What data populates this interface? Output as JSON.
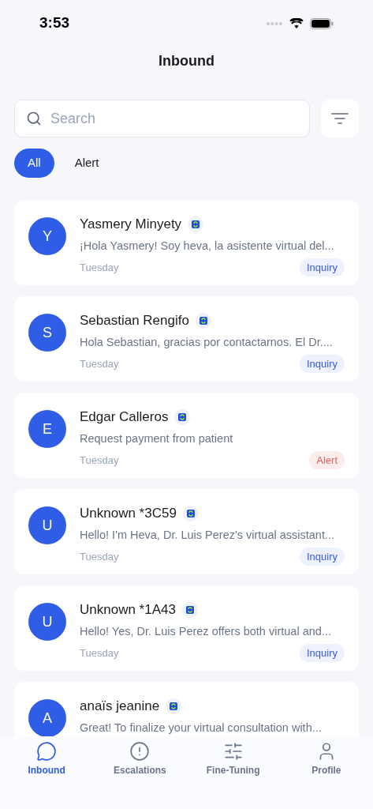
{
  "status_bar": {
    "time": "3:53"
  },
  "title": "Inbound",
  "search": {
    "placeholder": "Search"
  },
  "filters": [
    {
      "label": "All",
      "selected": true
    },
    {
      "label": "Alert",
      "selected": false
    }
  ],
  "conversations": [
    {
      "initial": "Y",
      "name": "Yasmery Minyety",
      "preview": "¡Hola Yasmery! Soy heva, la asistente virtual del...",
      "date": "Tuesday",
      "tag": {
        "label": "Inquiry",
        "kind": "inquiry"
      }
    },
    {
      "initial": "S",
      "name": "Sebastian Rengifo",
      "preview": "Hola Sebastian, gracias por contactarnos. El Dr....",
      "date": "Tuesday",
      "tag": {
        "label": "Inquiry",
        "kind": "inquiry"
      }
    },
    {
      "initial": "E",
      "name": "Edgar Calleros",
      "preview": "Request payment from patient",
      "date": "Tuesday",
      "tag": {
        "label": "Alert",
        "kind": "alert"
      }
    },
    {
      "initial": "U",
      "name": "Unknown *3C59",
      "preview": "Hello! I'm Heva, Dr. Luis Perez's virtual assistant...",
      "date": "Tuesday",
      "tag": {
        "label": "Inquiry",
        "kind": "inquiry"
      }
    },
    {
      "initial": "U",
      "name": "Unknown *1A43",
      "preview": "Hello! Yes, Dr. Luis Perez offers both virtual and...",
      "date": "Tuesday",
      "tag": {
        "label": "Inquiry",
        "kind": "inquiry"
      }
    },
    {
      "initial": "A",
      "name": "anaïs jeanine",
      "preview": "Great! To finalize your virtual consultation with..."
    }
  ],
  "tab_bar": [
    {
      "label": "Inbound",
      "kind": "chat",
      "selected": true
    },
    {
      "label": "Escalations",
      "kind": "alert",
      "selected": false
    },
    {
      "label": "Fine-Tuning",
      "kind": "sliders",
      "selected": false
    },
    {
      "label": "Profile",
      "kind": "person",
      "selected": false
    }
  ]
}
